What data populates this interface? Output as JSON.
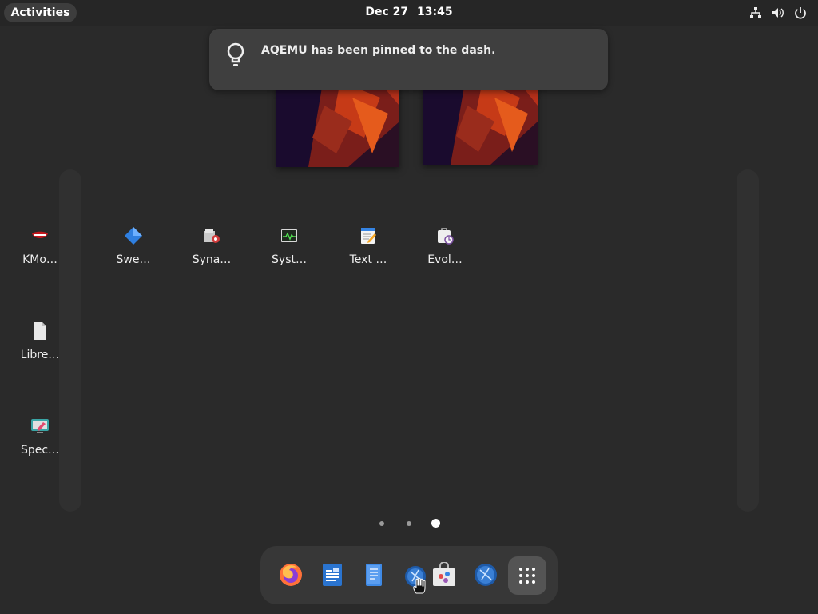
{
  "topbar": {
    "activities_label": "Activities",
    "date": "Dec 27",
    "time": "13:45",
    "tray_icons": [
      "network-icon",
      "volume-icon",
      "power-icon"
    ]
  },
  "notification": {
    "icon": "lightbulb-icon",
    "message": "AQEMU has been pinned to the dash."
  },
  "app_grid": {
    "left_column": [
      {
        "label": "KMo…",
        "icon": "kmouth-icon"
      },
      {
        "label": "Libre…",
        "icon": "libreoffice-icon"
      },
      {
        "label": "Spec…",
        "icon": "spectacle-icon"
      }
    ],
    "row": [
      {
        "label": "Swe…",
        "icon": "sweeper-icon"
      },
      {
        "label": "Syna…",
        "icon": "synaptic-icon"
      },
      {
        "label": "Syst…",
        "icon": "system-monitor-icon"
      },
      {
        "label": "Text …",
        "icon": "text-editor-icon"
      },
      {
        "label": "Evol…",
        "icon": "evolution-icon"
      }
    ]
  },
  "page_indicator": {
    "pages": 3,
    "current": 3
  },
  "dash": {
    "items": [
      "firefox-icon",
      "libreoffice-writer-icon",
      "text-editor-icon",
      "aqemu-icon",
      "software-icon",
      "aqemu-pinned-icon",
      "show-apps-icon"
    ]
  },
  "colors": {
    "background": "#2a2a2a",
    "topbar": "#262626",
    "notification": "#3f3f3f",
    "dash": "#373737"
  }
}
